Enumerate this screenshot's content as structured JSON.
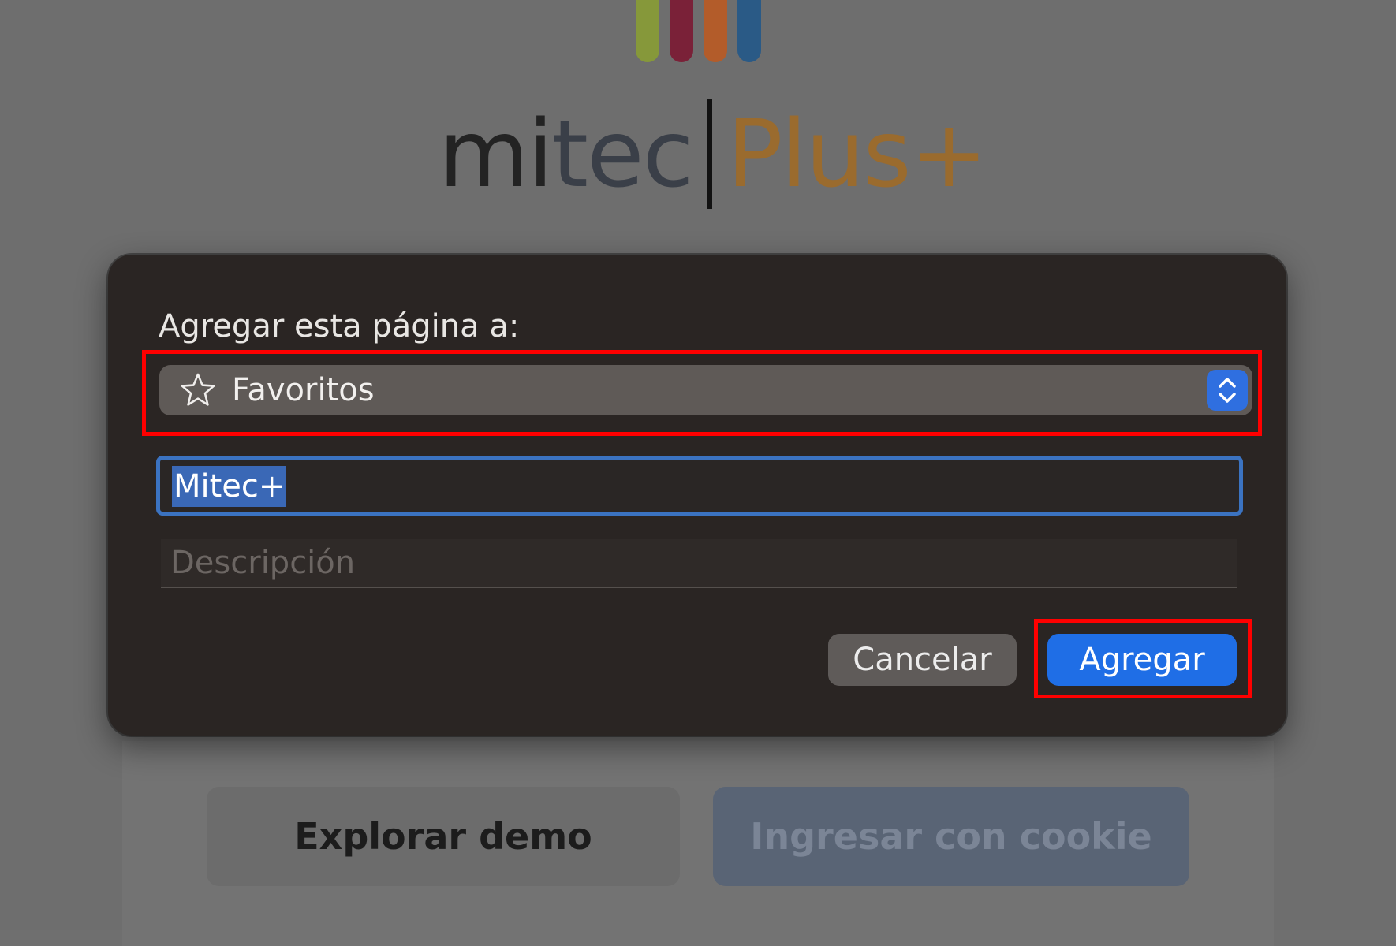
{
  "background": {
    "logo": {
      "text_mi": "mi",
      "text_tec": "tec",
      "text_plus": "Plus+",
      "bar_colors": [
        "#86983a",
        "#7a2138",
        "#b35c2a",
        "#2a5a86"
      ]
    },
    "buttons": {
      "explore_demo": "Explorar demo",
      "cookie_login": "Ingresar con cookie"
    }
  },
  "dialog": {
    "label": "Agregar esta página a:",
    "folder": {
      "icon": "star-icon",
      "selected": "Favoritos"
    },
    "name_input": {
      "value": "Mitec+",
      "selected": true
    },
    "description": {
      "placeholder": "Descripción",
      "value": ""
    },
    "buttons": {
      "cancel": "Cancelar",
      "add": "Agregar"
    }
  },
  "colors": {
    "dialog_bg": "#2a2523",
    "accent_blue": "#1f6ee6",
    "highlight_red": "#ff0000"
  }
}
